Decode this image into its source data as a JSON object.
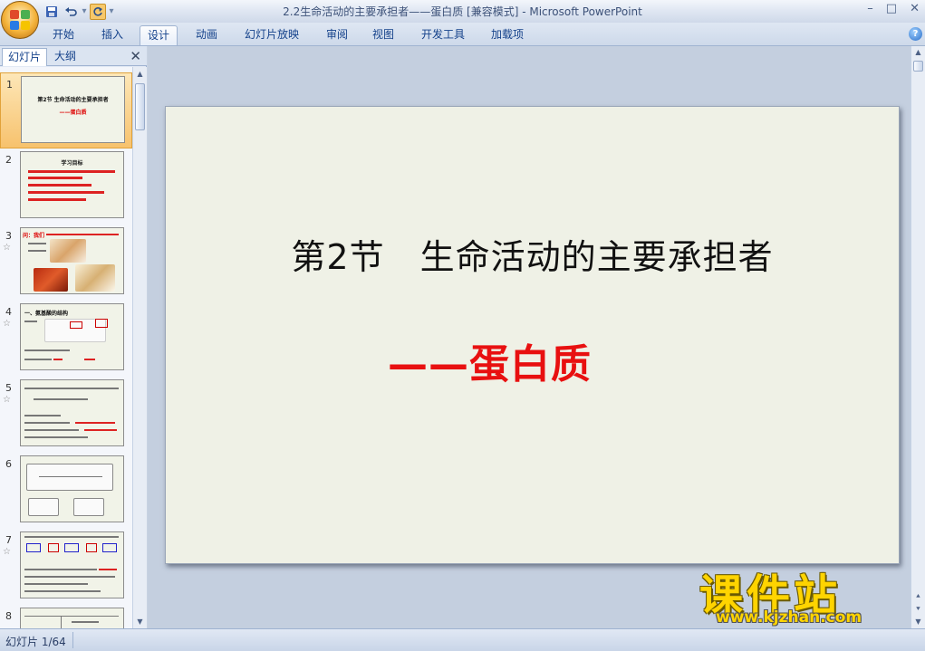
{
  "window": {
    "title": "2.2生命活动的主要承担者——蛋白质 [兼容模式] - Microsoft PowerPoint",
    "controls": [
      "–",
      "□",
      "✕"
    ]
  },
  "qat": {
    "save_icon": "save-icon",
    "undo_icon": "undo-icon",
    "redo_icon": "redo-icon"
  },
  "ribbon": {
    "tabs": [
      "开始",
      "插入",
      "设计",
      "动画",
      "幻灯片放映",
      "审阅",
      "视图",
      "开发工具",
      "加载项"
    ],
    "active_tab": "设计",
    "help": "?"
  },
  "panel": {
    "tabs": [
      "幻灯片",
      "大纲"
    ],
    "close": "✕",
    "thumbnails": [
      {
        "num": "1",
        "title": "第2节  生命活动的主要承担者",
        "subtitle": "——蛋白质"
      },
      {
        "num": "2",
        "title": "学习目标"
      },
      {
        "num": "3",
        "title": "问：我们"
      },
      {
        "num": "4",
        "title": "一、氨基酸的结构"
      },
      {
        "num": "5",
        "title": ""
      },
      {
        "num": "6",
        "title": ""
      },
      {
        "num": "7",
        "title": ""
      },
      {
        "num": "8",
        "title": ""
      }
    ],
    "star": "☆"
  },
  "slide": {
    "title": "第2节　生命活动的主要承担者",
    "subtitle": "——蛋白质",
    "subtitle_color": "#e81010"
  },
  "watermark": {
    "big": "课件站",
    "url": "www.kjzhan.com"
  },
  "status": {
    "slide_counter": "幻灯片 1/64"
  }
}
